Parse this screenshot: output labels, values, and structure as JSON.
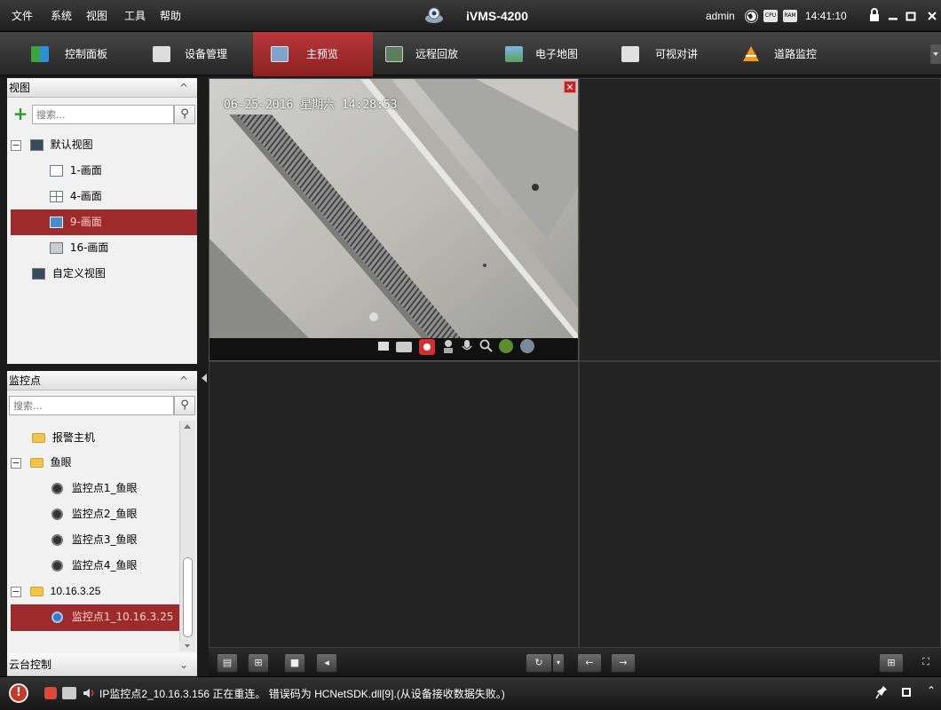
{
  "menu": [
    "文件",
    "系统",
    "视图",
    "工具",
    "帮助"
  ],
  "app_title": "iVMS-4200",
  "user": "admin",
  "cpu_label": "CPU",
  "ram_label": "RAM",
  "clock": "14:41:10",
  "tabs": [
    {
      "label": "控制面板",
      "icon": "control-panel-icon"
    },
    {
      "label": "设备管理",
      "icon": "device-management-icon"
    },
    {
      "label": "主预览",
      "icon": "main-view-icon",
      "active": true
    },
    {
      "label": "远程回放",
      "icon": "remote-playback-icon"
    },
    {
      "label": "电子地图",
      "icon": "e-map-icon"
    },
    {
      "label": "可视对讲",
      "icon": "video-intercom-icon"
    },
    {
      "label": "道路监控",
      "icon": "road-monitoring-icon"
    }
  ],
  "view_panel": {
    "title": "视图",
    "search_placeholder": "搜索...",
    "items": [
      {
        "label": "默认视图"
      },
      {
        "label": "1-画面"
      },
      {
        "label": "4-画面"
      },
      {
        "label": "9-画面",
        "selected": true
      },
      {
        "label": "16-画面"
      },
      {
        "label": "自定义视图"
      }
    ]
  },
  "camera_panel": {
    "title": "监控点",
    "search_placeholder": "搜索...",
    "items": [
      {
        "label": "报警主机"
      },
      {
        "label": "鱼眼"
      },
      {
        "label": "监控点1_鱼眼"
      },
      {
        "label": "监控点2_鱼眼"
      },
      {
        "label": "监控点3_鱼眼"
      },
      {
        "label": "监控点4_鱼眼"
      },
      {
        "label": "10.16.3.25"
      },
      {
        "label": "监控点1_10.16.3.25",
        "selected": true
      }
    ]
  },
  "ptz_panel": {
    "title": "云台控制"
  },
  "video": {
    "osd": "06-25-2016 星期六 14:28:53"
  },
  "status_message": "IP监控点2_10.16.3.156 正在重连。 错误码为 HCNetSDK.dll[9].(从设备接收数据失败。)",
  "colors": {
    "accent": "#9e2b2b",
    "tab_active": "#a92d2f"
  }
}
